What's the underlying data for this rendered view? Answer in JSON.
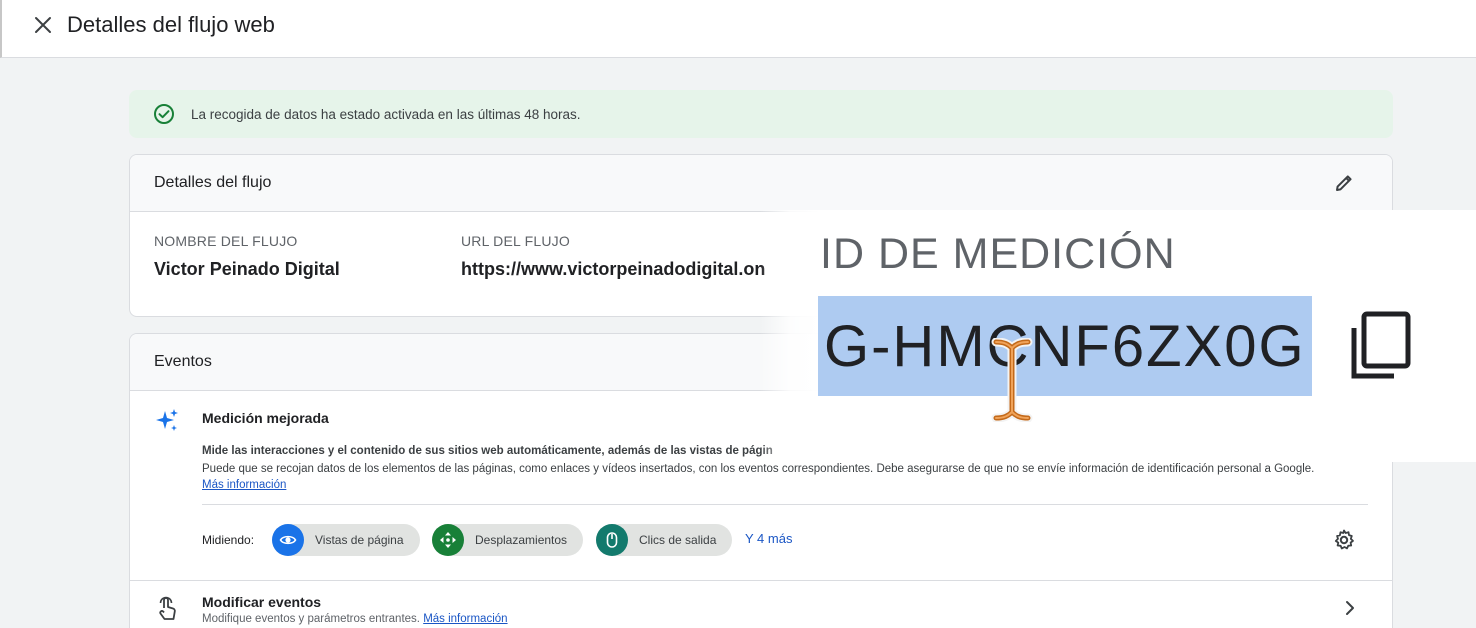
{
  "header": {
    "title": "Detalles del flujo web",
    "close_icon": "close-icon"
  },
  "alert": {
    "text": "La recogida de datos ha estado activada en las últimas 48 horas.",
    "icon": "check-circle-icon",
    "color": "#188038"
  },
  "stream_details": {
    "heading": "Detalles del flujo",
    "edit_icon": "pencil-icon",
    "name_label": "NOMBRE DEL FLUJO",
    "name_value": "Victor Peinado Digital",
    "url_label": "URL DEL FLUJO",
    "url_value": "https://www.victorpeinadodigital.on",
    "id_label": "ID DE MEDICIÓN",
    "id_value": "G-HMCNF6ZX0G",
    "copy_icon": "copy-icon"
  },
  "events": {
    "heading": "Eventos",
    "enhanced": {
      "title": "Medición mejorada",
      "description_1": "Mide las interacciones y el contenido de sus sitios web automáticamente, además de las vistas de págin",
      "description_2": "Puede que se recojan datos de los elementos de las páginas, como enlaces y vídeos insertados, con los eventos correspondientes. Debe asegurarse de que no se envíe información de identificación personal a Google.",
      "learn_more": "Más información",
      "measuring_label": "Midiendo:",
      "chips": [
        {
          "label": "Vistas de página",
          "icon": "eye-icon",
          "color": "#1a73e8"
        },
        {
          "label": "Desplazamientos",
          "icon": "move-arrows-icon",
          "color": "#188038"
        },
        {
          "label": "Clics de salida",
          "icon": "mouse-icon",
          "color": "#137a6d"
        }
      ],
      "more": "Y 4 más",
      "settings_icon": "gear-icon"
    },
    "modify": {
      "title": "Modificar eventos",
      "description": "Modifique eventos y parámetros entrantes.",
      "learn_more": "Más información",
      "chevron_icon": "chevron-right-icon"
    }
  }
}
